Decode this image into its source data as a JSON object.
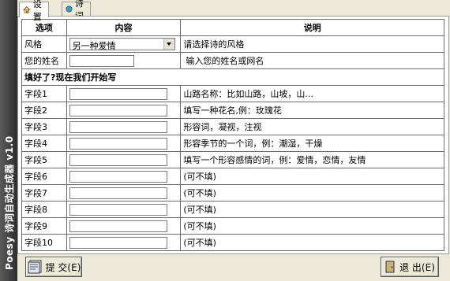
{
  "app": {
    "title": "Poesy 诗词自动生成器 v1.0"
  },
  "tabs": [
    {
      "label": "设置",
      "icon": "house-icon"
    },
    {
      "label": "诗词",
      "icon": "globe-icon"
    }
  ],
  "table": {
    "headers": [
      "选项",
      "内容",
      "说明"
    ],
    "style_row": {
      "label": "风格",
      "value": "另一种爱情",
      "desc": "请选择诗的风格"
    },
    "name_row": {
      "label": "您的姓名",
      "value": "",
      "desc": "输入您的姓名或网名"
    },
    "section_title": "填好了?现在我们开始写",
    "fields": [
      {
        "label": "字段1",
        "value": "",
        "desc": "山路名称：比如山路，山坡，山..."
      },
      {
        "label": "字段2",
        "value": "",
        "desc": "填写一种花名,例：玫瑰花"
      },
      {
        "label": "字段3",
        "value": "",
        "desc": "形容词，凝视，注视"
      },
      {
        "label": "字段4",
        "value": "",
        "desc": "形容季节的一个词，例：潮湿，干燥"
      },
      {
        "label": "字段5",
        "value": "",
        "desc": "填写一个形容感情的词，例：爱情，恋情，友情"
      },
      {
        "label": "字段6",
        "value": "",
        "desc": "(可不填)"
      },
      {
        "label": "字段7",
        "value": "",
        "desc": "(可不填)"
      },
      {
        "label": "字段8",
        "value": "",
        "desc": "(可不填)"
      },
      {
        "label": "字段9",
        "value": "",
        "desc": "(可不填)"
      },
      {
        "label": "字段10",
        "value": "",
        "desc": "(可不填)"
      }
    ]
  },
  "buttons": {
    "submit": "提 交(E)",
    "exit": "退 出(E)"
  }
}
